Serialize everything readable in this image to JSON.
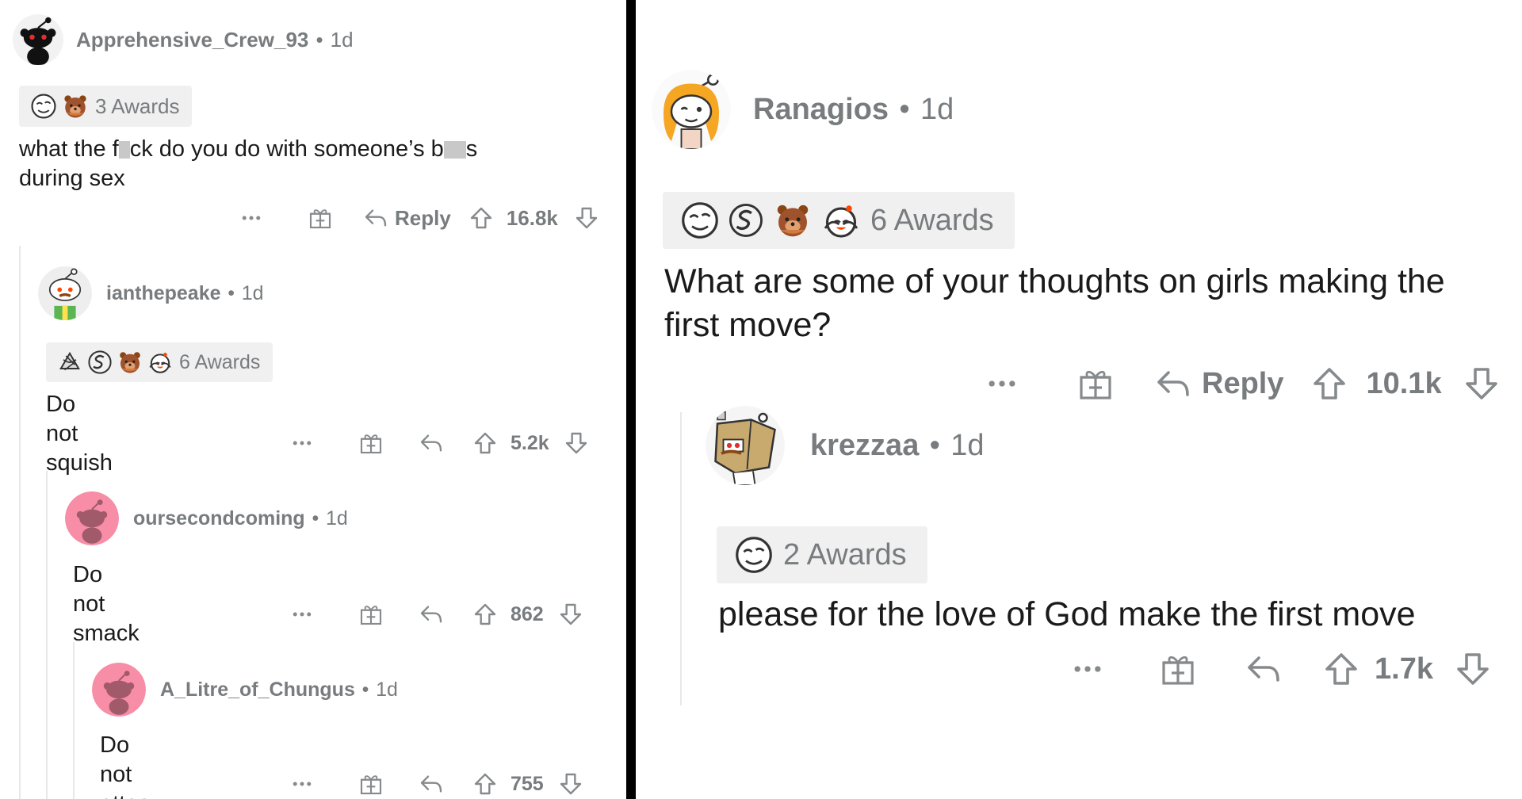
{
  "left": {
    "comments": [
      {
        "username": "Apprehensive_Crew_93",
        "age": "1d",
        "awards_label": "3 Awards",
        "body_parts": [
          "what the f",
          "ck do you do with someone’s b",
          "s",
          "during sex"
        ],
        "reply_label": "Reply",
        "score": "16.8k"
      },
      {
        "username": "ianthepeake",
        "age": "1d",
        "awards_label": "6 Awards",
        "body": "Do not squish",
        "score": "5.2k"
      },
      {
        "username": "oursecondcoming",
        "age": "1d",
        "body": "Do not smack",
        "score": "862"
      },
      {
        "username": "A_Litre_of_Chungus",
        "age": "1d",
        "body": "Do not attac",
        "score": "755"
      }
    ]
  },
  "right": {
    "comments": [
      {
        "username": "Ranagios",
        "age": "1d",
        "awards_label": "6 Awards",
        "body": "What are some of your thoughts on girls making the first move?",
        "reply_label": "Reply",
        "score": "10.1k"
      },
      {
        "username": "krezzaa",
        "age": "1d",
        "awards_label": "2 Awards",
        "body": "please for the love of God make the first move",
        "score": "1.7k"
      }
    ]
  },
  "separator": "•",
  "more_label": "···",
  "colors": {
    "muted": "#787c7e",
    "text": "#1a1a1b",
    "award_bg": "#f0f0f0",
    "thread_line": "#e8e8e8",
    "avatar_pink": "#f78da7"
  }
}
